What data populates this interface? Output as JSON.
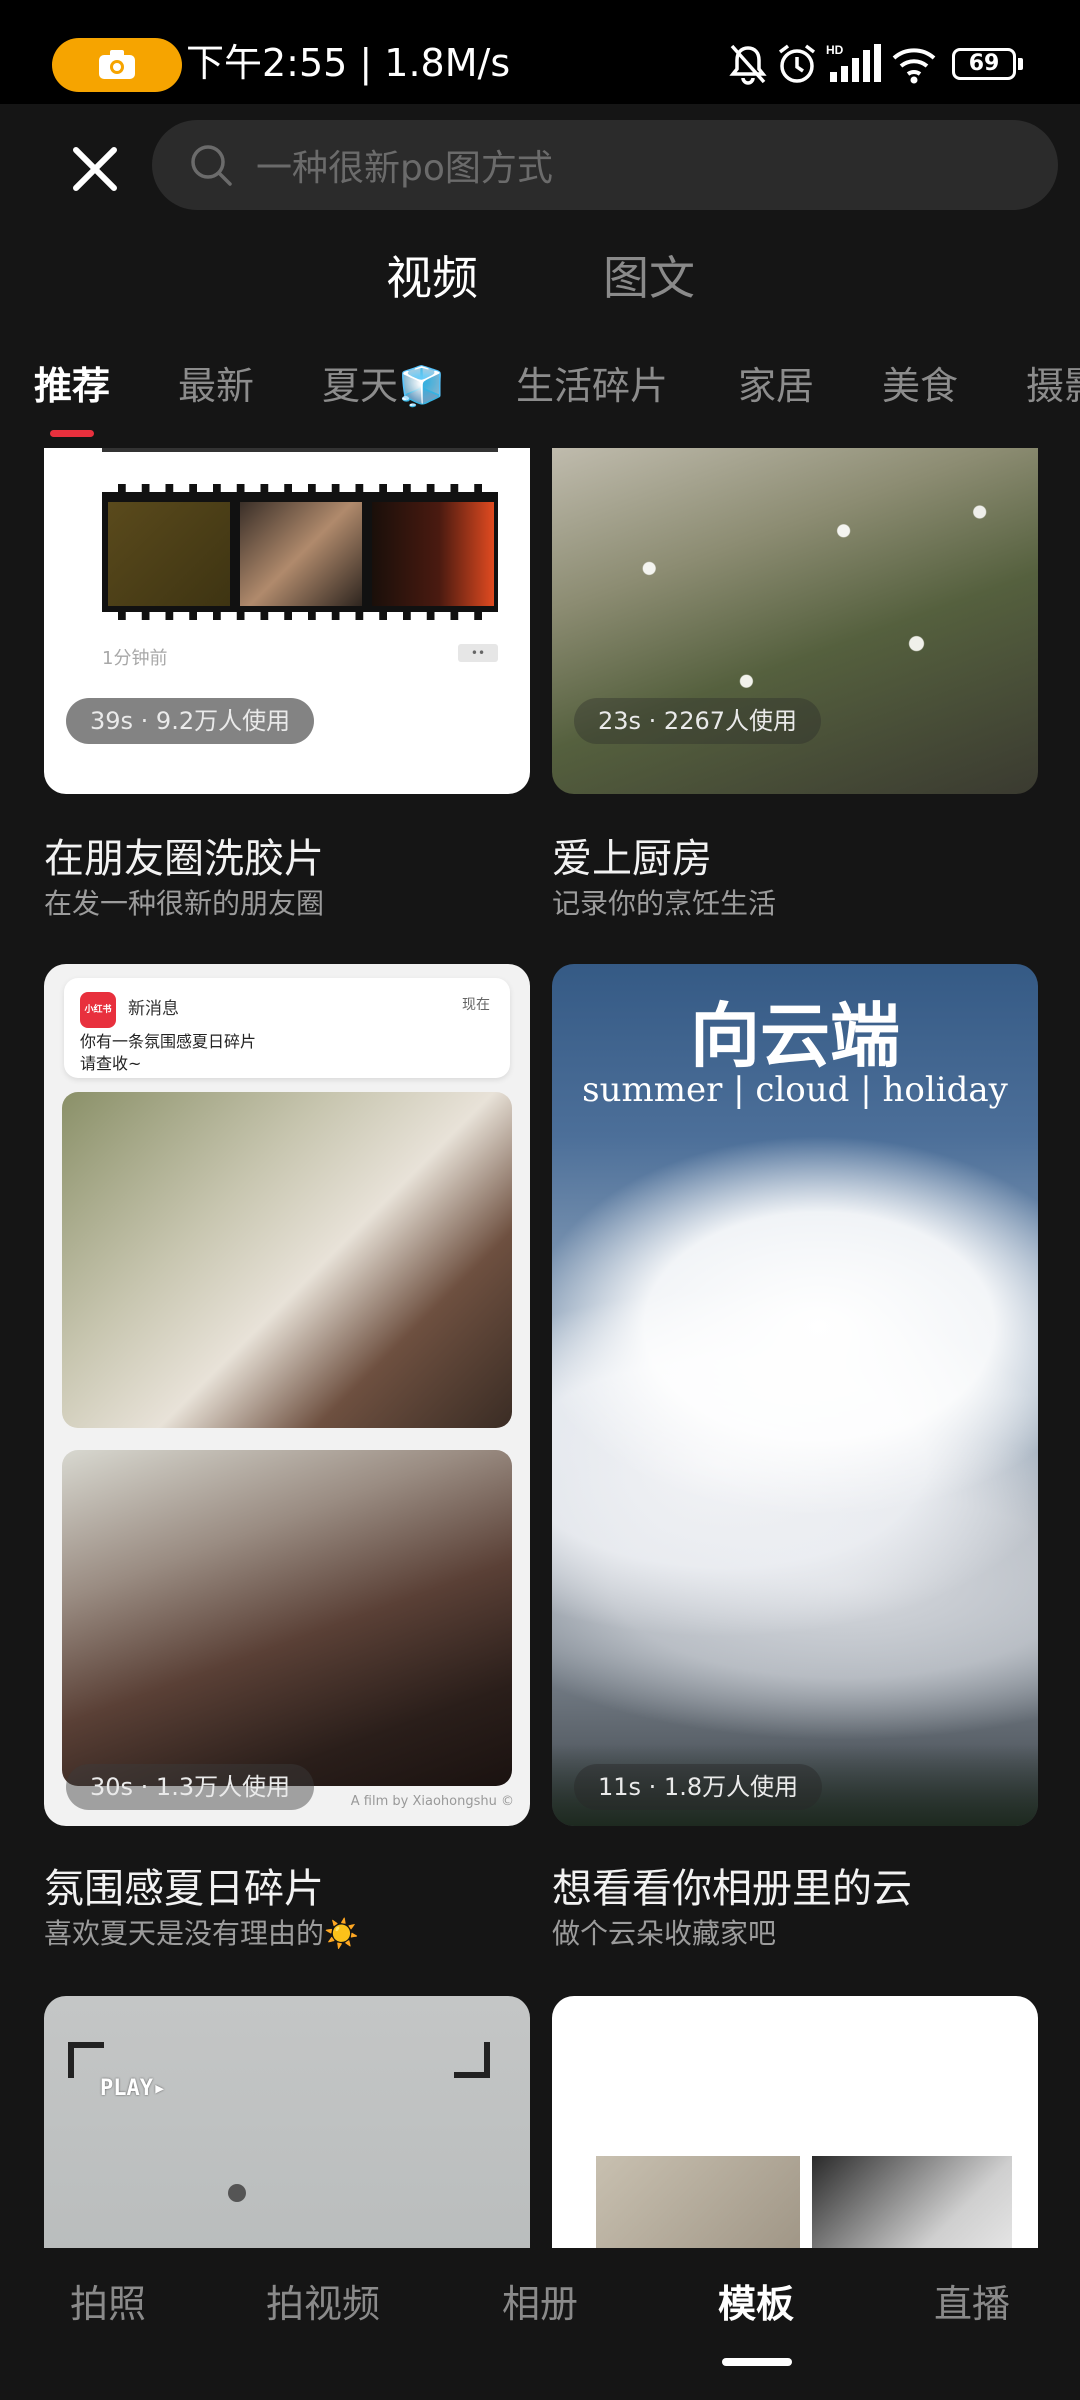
{
  "status_bar": {
    "time_speed": "下午2:55 | 1.8M/s",
    "battery": "69"
  },
  "search": {
    "placeholder": "一种很新po图方式"
  },
  "top_tabs": [
    {
      "label": "视频",
      "active": true
    },
    {
      "label": "图文",
      "active": false
    }
  ],
  "categories": [
    {
      "label": "推荐",
      "active": true
    },
    {
      "label": "最新"
    },
    {
      "label": "夏天🧊"
    },
    {
      "label": "生活碎片"
    },
    {
      "label": "家居"
    },
    {
      "label": "美食"
    },
    {
      "label": "摄影"
    }
  ],
  "templates": [
    {
      "title": "在朋友圈洗胶片",
      "subtitle": "在发一种很新的朋友圈",
      "usage": "39s · 9.2万人使用",
      "thumb_time": "1分钟前"
    },
    {
      "title": "爱上厨房",
      "subtitle": "记录你的烹饪生活",
      "usage": "23s · 2267人使用"
    },
    {
      "title": "氛围感夏日碎片",
      "subtitle": "喜欢夏天是没有理由的☀️",
      "usage": "30s · 1.3万人使用",
      "notif_app": "小红书",
      "notif_title": "新消息",
      "notif_time": "现在",
      "notif_body_1": "你有一条氛围感夏日碎片",
      "notif_body_2": "请查收~",
      "credit": "A film by Xiaohongshu ©"
    },
    {
      "title": "想看看你相册里的云",
      "subtitle": "做个云朵收藏家吧",
      "usage": "11s · 1.8万人使用",
      "cover_title": "向云端",
      "cover_sub": "summer | cloud | holiday"
    },
    {
      "cover_text": "PLAY▸"
    },
    {}
  ],
  "bottom_nav": [
    {
      "label": "拍照"
    },
    {
      "label": "拍视频"
    },
    {
      "label": "相册"
    },
    {
      "label": "模板",
      "active": true
    },
    {
      "label": "直播"
    }
  ],
  "colors": {
    "accent": "#e8303d",
    "status_cam": "#f6a400",
    "background": "#151515"
  }
}
